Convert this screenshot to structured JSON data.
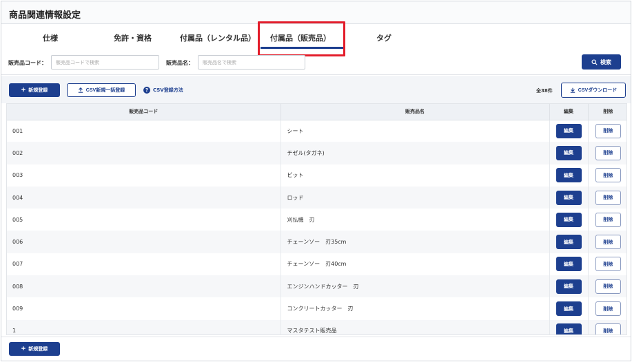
{
  "page": {
    "title": "商品関連情報設定"
  },
  "tabs": [
    {
      "label": "仕様"
    },
    {
      "label": "免許・資格"
    },
    {
      "label": "付属品（レンタル品）"
    },
    {
      "label": "付属品（販売品）"
    },
    {
      "label": "タグ"
    }
  ],
  "search": {
    "code_label": "販売品コード：",
    "code_placeholder": "販売品コードで検索",
    "name_label": "販売品名：",
    "name_placeholder": "販売品名で検索",
    "button_label": "検索"
  },
  "toolbar": {
    "new_label": "新規登録",
    "csv_bulk_label": "CSV新規一括登録",
    "csv_help_label": "CSV登録方法",
    "count_label": "全38件",
    "csv_download_label": "CSVダウンロード"
  },
  "table": {
    "headers": {
      "code": "販売品コード",
      "name": "販売品名",
      "edit": "編集",
      "delete": "削除"
    },
    "edit_label": "編集",
    "delete_label": "削除",
    "rows": [
      {
        "code": "001",
        "name": "シート"
      },
      {
        "code": "002",
        "name": "チゼル(タガネ)"
      },
      {
        "code": "003",
        "name": "ビット"
      },
      {
        "code": "004",
        "name": "ロッド"
      },
      {
        "code": "005",
        "name": "刈払機　刃"
      },
      {
        "code": "006",
        "name": "チェーンソー　刃35cm"
      },
      {
        "code": "007",
        "name": "チェーンソー　刃40cm"
      },
      {
        "code": "008",
        "name": "エンジンハンドカッター　刃"
      },
      {
        "code": "009",
        "name": "コンクリートカッター　刃"
      },
      {
        "code": "1",
        "name": "マスタテスト販売品"
      }
    ]
  },
  "footer": {
    "new_label": "新規登録"
  },
  "colors": {
    "primary": "#1d3f8f",
    "highlight": "#e31d2b"
  }
}
